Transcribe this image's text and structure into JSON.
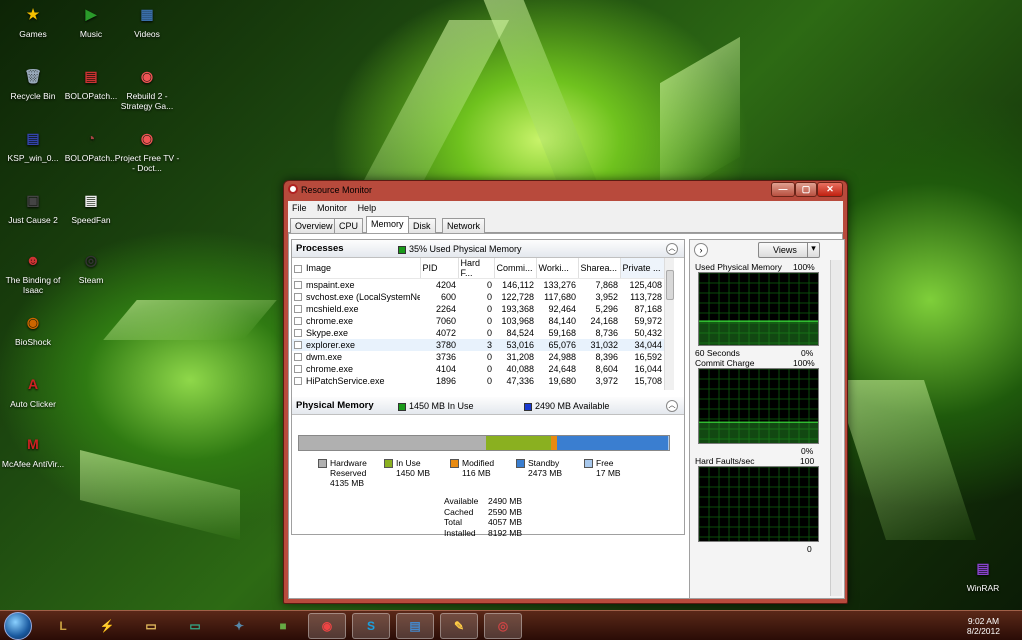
{
  "desktop": {
    "icons": [
      {
        "label": "Games",
        "glyph": "★",
        "color": "#f5c000"
      },
      {
        "label": "Music",
        "glyph": "▶",
        "color": "#2a9a2a"
      },
      {
        "label": "Videos",
        "glyph": "▦",
        "color": "#3a6ea8"
      },
      {
        "label": "Recycle Bin",
        "glyph": "🗑",
        "color": "#9ab"
      },
      {
        "label": "BOLOPatch...",
        "glyph": "▤",
        "color": "#c33"
      },
      {
        "label": "Rebuild 2 - Strategy Ga...",
        "glyph": "◉",
        "color": "#e55"
      },
      {
        "label": "KSP_win_0...",
        "glyph": "▤",
        "color": "#34a"
      },
      {
        "label": "BOLOPatch...",
        "glyph": "◔",
        "color": "#a44"
      },
      {
        "label": "Project Free TV -- Doct...",
        "glyph": "◉",
        "color": "#e55"
      },
      {
        "label": "Just Cause 2",
        "glyph": "▣",
        "color": "#444"
      },
      {
        "label": "SpeedFan",
        "glyph": "▤",
        "color": "#eee"
      },
      {
        "label": "The Binding of Isaac",
        "glyph": "☻",
        "color": "#c33"
      },
      {
        "label": "Steam",
        "glyph": "◎",
        "color": "#333"
      },
      {
        "label": "BioShock",
        "glyph": "◉",
        "color": "#c60"
      },
      {
        "label": "Auto Clicker",
        "glyph": "A",
        "color": "#c22"
      },
      {
        "label": "McAfee AntiVir...",
        "glyph": "M",
        "color": "#c22"
      },
      {
        "label": "WinRAR",
        "glyph": "▤",
        "color": "#84c"
      }
    ]
  },
  "window": {
    "title": "Resource Monitor",
    "controls": {
      "minimize": "—",
      "maximize": "▢",
      "close": "✕"
    },
    "menu": [
      "File",
      "Monitor",
      "Help"
    ],
    "tabs": [
      "Overview",
      "CPU",
      "Memory",
      "Disk",
      "Network"
    ],
    "active_tab": "Memory"
  },
  "processes": {
    "title": "Processes",
    "usage_label": "35% Used Physical Memory",
    "usage_color": "#1a9a1a",
    "columns": [
      "Image",
      "PID",
      "Hard F...",
      "Commi...",
      "Worki...",
      "Sharea...",
      "Private ..."
    ],
    "rows": [
      [
        "mspaint.exe",
        "4204",
        "0",
        "146,112",
        "133,276",
        "7,868",
        "125,408"
      ],
      [
        "svchost.exe (LocalSystemNet...",
        "600",
        "0",
        "122,728",
        "117,680",
        "3,952",
        "113,728"
      ],
      [
        "mcshield.exe",
        "2264",
        "0",
        "193,368",
        "92,464",
        "5,296",
        "87,168"
      ],
      [
        "chrome.exe",
        "7060",
        "0",
        "103,968",
        "84,140",
        "24,168",
        "59,972"
      ],
      [
        "Skype.exe",
        "4072",
        "0",
        "84,524",
        "59,168",
        "8,736",
        "50,432"
      ],
      [
        "explorer.exe",
        "3780",
        "3",
        "53,016",
        "65,076",
        "31,032",
        "34,044"
      ],
      [
        "dwm.exe",
        "3736",
        "0",
        "31,208",
        "24,988",
        "8,396",
        "16,592"
      ],
      [
        "chrome.exe",
        "4104",
        "0",
        "40,088",
        "24,648",
        "8,604",
        "16,044"
      ],
      [
        "HiPatchService.exe",
        "1896",
        "0",
        "47,336",
        "19,680",
        "3,972",
        "15,708"
      ]
    ],
    "selected_row": 5
  },
  "physical_memory": {
    "title": "Physical Memory",
    "in_use_label": "1450 MB In Use",
    "available_label": "2490 MB Available",
    "in_use_color": "#1a9a1a",
    "available_color": "#1a3ad0",
    "bar": [
      {
        "name": "Hardware Reserved",
        "mb": 4135,
        "color": "#b0b0b0"
      },
      {
        "name": "In Use",
        "mb": 1450,
        "color": "#8ab020"
      },
      {
        "name": "Modified",
        "mb": 116,
        "color": "#e88a10"
      },
      {
        "name": "Standby",
        "mb": 2473,
        "color": "#3a7ed0"
      },
      {
        "name": "Free",
        "mb": 17,
        "color": "#a8c8ec"
      }
    ],
    "legend": [
      {
        "name": "Hardware Reserved",
        "value": "4135 MB",
        "color": "#b0b0b0"
      },
      {
        "name": "In Use",
        "value": "1450 MB",
        "color": "#8ab020"
      },
      {
        "name": "Modified",
        "value": "116 MB",
        "color": "#e88a10"
      },
      {
        "name": "Standby",
        "value": "2473 MB",
        "color": "#3a7ed0"
      },
      {
        "name": "Free",
        "value": "17 MB",
        "color": "#a8c8ec"
      }
    ],
    "stats": [
      [
        "Available",
        "2490 MB"
      ],
      [
        "Cached",
        "2590 MB"
      ],
      [
        "Total",
        "4057 MB"
      ],
      [
        "Installed",
        "8192 MB"
      ]
    ]
  },
  "graphs": {
    "views_label": "Views",
    "g1": {
      "title": "Used Physical Memory",
      "max": "100%",
      "left_bottom": "60 Seconds",
      "right_bottom": "0%",
      "series": [
        35,
        35,
        35,
        35,
        35,
        35,
        35,
        35,
        35,
        35,
        35,
        35,
        35,
        35,
        35,
        35,
        35,
        35,
        35,
        35,
        35,
        35,
        35,
        35,
        35,
        35,
        35,
        35,
        35,
        35
      ]
    },
    "g2": {
      "title": "Commit Charge",
      "max": "100%",
      "right_bottom": "0%",
      "series": [
        30,
        30,
        30,
        30,
        30,
        30,
        30,
        30,
        30,
        30,
        30,
        30,
        30,
        30,
        30,
        30,
        30,
        30,
        30,
        30,
        30,
        30,
        30,
        30,
        30,
        30,
        30,
        30,
        30,
        30
      ]
    },
    "g3": {
      "title": "Hard Faults/sec",
      "max": "100",
      "right_bottom": "0",
      "series": [
        0,
        0,
        0,
        0,
        0,
        0,
        0,
        0,
        0,
        0,
        0,
        0,
        0,
        0,
        0,
        0,
        0,
        0,
        0,
        0,
        0,
        0,
        0,
        0,
        0,
        0,
        0,
        0,
        0,
        0
      ]
    }
  },
  "taskbar": {
    "apps": [
      {
        "name": "league",
        "glyph": "L",
        "color": "#c8a040"
      },
      {
        "name": "razer",
        "glyph": "⚡",
        "color": "#2c2"
      },
      {
        "name": "explorer",
        "glyph": "▭",
        "color": "#e8c060"
      },
      {
        "name": "monitor",
        "glyph": "▭",
        "color": "#3a8"
      },
      {
        "name": "game",
        "glyph": "✦",
        "color": "#58a"
      },
      {
        "name": "minecraft",
        "glyph": "■",
        "color": "#6a4"
      },
      {
        "name": "chrome",
        "glyph": "◉",
        "color": "#e44"
      },
      {
        "name": "skype",
        "glyph": "S",
        "color": "#1aa0e0"
      },
      {
        "name": "network",
        "glyph": "▤",
        "color": "#48c"
      },
      {
        "name": "paint",
        "glyph": "✎",
        "color": "#fc4"
      },
      {
        "name": "resmon",
        "glyph": "◎",
        "color": "#c44"
      }
    ],
    "active": [
      6,
      7,
      8,
      9,
      10
    ],
    "time": "9:02 AM",
    "date": "8/2/2012"
  }
}
